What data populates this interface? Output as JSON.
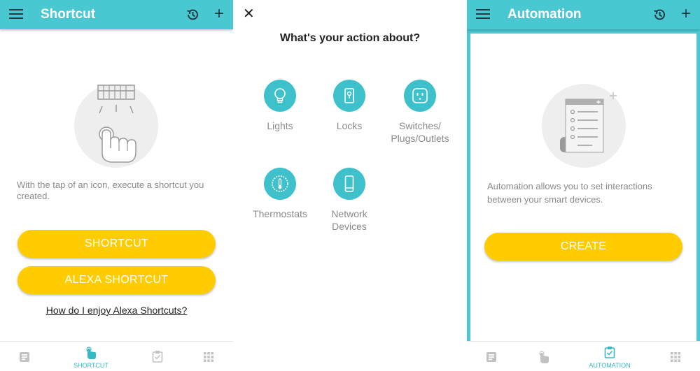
{
  "shortcut_panel": {
    "title": "Shortcut",
    "description": "With the tap of an icon, execute a shortcut you created.",
    "shortcut_button": "SHORTCUT",
    "alexa_button": "ALEXA SHORTCUT",
    "help_link": "How do I enjoy Alexa Shortcuts?",
    "active_tab_label": "SHORTCUT"
  },
  "action_panel": {
    "heading": "What's your action about?",
    "categories": [
      {
        "label": "Lights",
        "icon": "bulb-icon"
      },
      {
        "label": "Locks",
        "icon": "lock-icon"
      },
      {
        "label": "Switches/\nPlugs/Outlets",
        "icon": "outlet-icon"
      },
      {
        "label": "Thermostats",
        "icon": "thermostat-icon"
      },
      {
        "label": "Network\nDevices",
        "icon": "phone-icon"
      }
    ]
  },
  "automation_panel": {
    "title": "Automation",
    "description": "Automation allows you to set interactions between your smart devices.",
    "create_button": "CREATE",
    "active_tab_label": "AUTOMATION"
  },
  "colors": {
    "accent": "#4ac8d2",
    "button": "#ffcc00",
    "icon_dark": "#1f3a40",
    "muted_text": "#8a8a8a"
  }
}
